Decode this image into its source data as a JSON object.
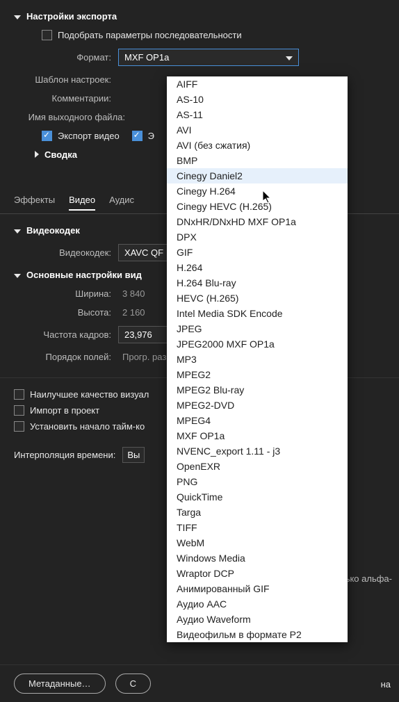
{
  "export": {
    "title": "Настройки экспорта",
    "match_sequence": "Подобрать параметры последовательности",
    "format_label": "Формат:",
    "format_value": "MXF OP1a",
    "preset_label": "Шаблон настроек:",
    "comments_label": "Комментарии:",
    "output_name_label": "Имя выходного файла:",
    "export_video": "Экспорт видео",
    "export_audio_trunc": "Э",
    "summary_label": "Сводка"
  },
  "tabs": {
    "effects": "Эффекты",
    "video": "Видео",
    "audio_trunc": "Аудис"
  },
  "codec": {
    "section": "Видеокодек",
    "label": "Видеокодек:",
    "value_trunc": "XAVC QF"
  },
  "basic": {
    "section": "Основные настройки вид",
    "width_label": "Ширина:",
    "width_value": "3 840",
    "height_label": "Высота:",
    "height_value": "2 160",
    "fps_label": "Частота кадров:",
    "fps_value": "23,976",
    "field_order_label": "Порядок полей:",
    "field_order_value": "Прогр. раз"
  },
  "checks": {
    "best_quality": "Наилучшее качество визуал",
    "import_project": "Импорт в проект",
    "set_start_tc": "Установить начало тайм-ко",
    "alpha_only_trunc": "ько альфа-"
  },
  "interp": {
    "label": "Интерполяция времени:",
    "value_trunc": "Вы"
  },
  "buttons": {
    "metadata": "Метаданные…",
    "second_trunc": "С",
    "last_trunc": "на"
  },
  "format_options": [
    "AIFF",
    "AS-10",
    "AS-11",
    "AVI",
    "AVI (без сжатия)",
    "BMP",
    "Cinegy Daniel2",
    "Cinegy H.264",
    "Cinegy HEVC (H.265)",
    "DNxHR/DNxHD MXF OP1a",
    "DPX",
    "GIF",
    "H.264",
    "H.264 Blu-ray",
    "HEVC (H.265)",
    "Intel Media SDK Encode",
    "JPEG",
    "JPEG2000 MXF OP1a",
    "MP3",
    "MPEG2",
    "MPEG2 Blu-ray",
    "MPEG2-DVD",
    "MPEG4",
    "MXF OP1a",
    "NVENC_export 1.11 - j3",
    "OpenEXR",
    "PNG",
    "QuickTime",
    "Targa",
    "TIFF",
    "WebM",
    "Windows Media",
    "Wraptor DCP",
    "Анимированный GIF",
    "Аудио AAC",
    "Аудио Waveform",
    "Видеофильм в формате P2"
  ],
  "highlight_index": 6
}
